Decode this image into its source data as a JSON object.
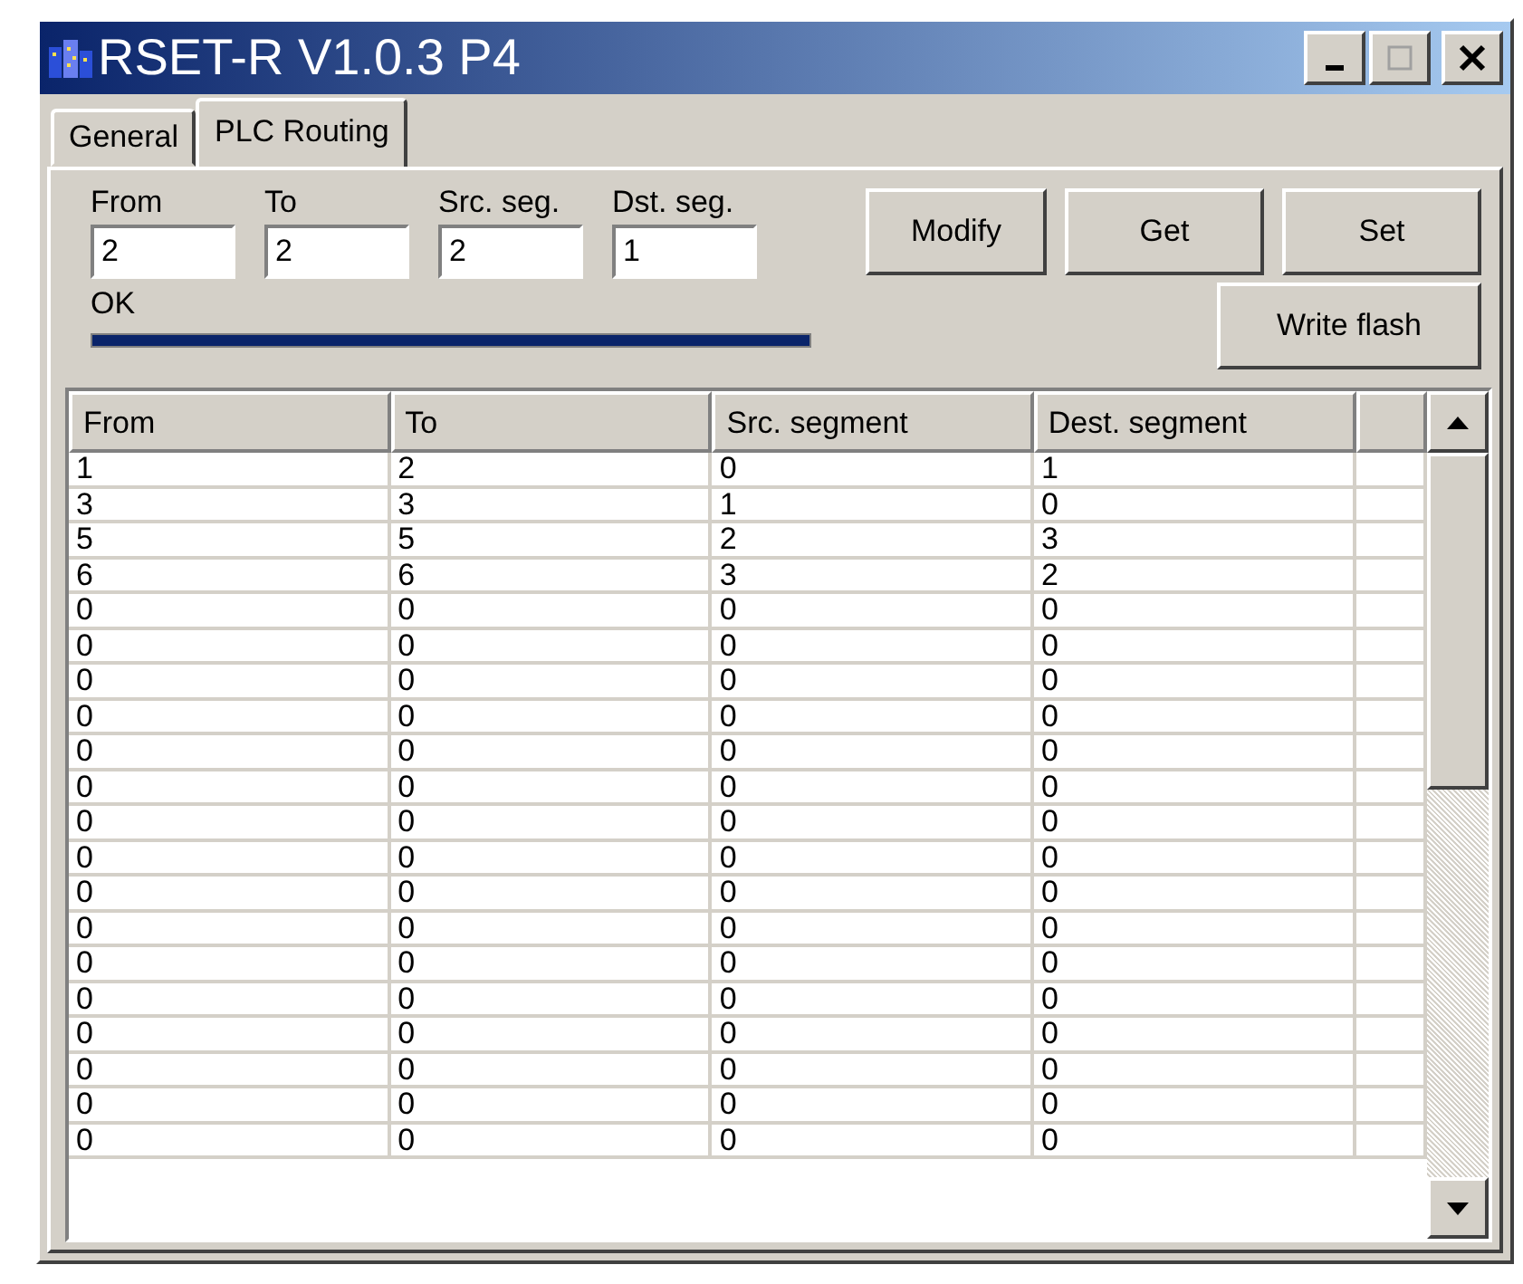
{
  "window": {
    "title": "RSET-R V1.0.3 P4"
  },
  "tabs": [
    {
      "label": "General",
      "selected": false
    },
    {
      "label": "PLC Routing",
      "selected": true
    }
  ],
  "fields": [
    {
      "label": "From",
      "value": "2"
    },
    {
      "label": "To",
      "value": "2"
    },
    {
      "label": "Src. seg.",
      "value": "2"
    },
    {
      "label": "Dst. seg.",
      "value": "1"
    }
  ],
  "buttons": [
    "Modify",
    "Get",
    "Set"
  ],
  "write_button": "Write flash",
  "status": "OK",
  "progress": {
    "level": 1
  },
  "table": {
    "columns": [
      "From",
      "To",
      "Src. segment",
      "Dest. segment"
    ],
    "rows": [
      [
        "1",
        "2",
        "0",
        "1"
      ],
      [
        "3",
        "3",
        "1",
        "0"
      ],
      [
        "5",
        "5",
        "2",
        "3"
      ],
      [
        "6",
        "6",
        "3",
        "2"
      ],
      [
        "0",
        "0",
        "0",
        "0"
      ],
      [
        "0",
        "0",
        "0",
        "0"
      ],
      [
        "0",
        "0",
        "0",
        "0"
      ],
      [
        "0",
        "0",
        "0",
        "0"
      ],
      [
        "0",
        "0",
        "0",
        "0"
      ],
      [
        "0",
        "0",
        "0",
        "0"
      ],
      [
        "0",
        "0",
        "0",
        "0"
      ],
      [
        "0",
        "0",
        "0",
        "0"
      ],
      [
        "0",
        "0",
        "0",
        "0"
      ],
      [
        "0",
        "0",
        "0",
        "0"
      ],
      [
        "0",
        "0",
        "0",
        "0"
      ],
      [
        "0",
        "0",
        "0",
        "0"
      ],
      [
        "0",
        "0",
        "0",
        "0"
      ],
      [
        "0",
        "0",
        "0",
        "0"
      ],
      [
        "0",
        "0",
        "0",
        "0"
      ],
      [
        "0",
        "0",
        "0",
        "0"
      ]
    ]
  }
}
